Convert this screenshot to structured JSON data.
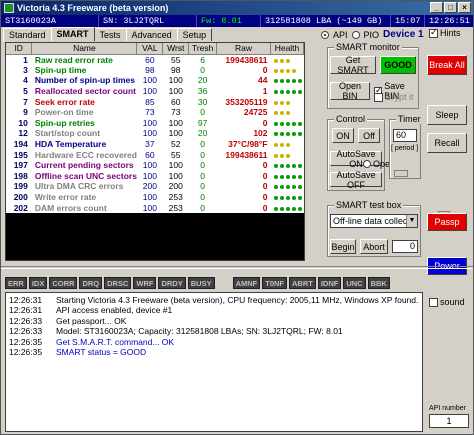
{
  "window": {
    "title": "Victoria 4.3 Freeware (beta version)",
    "min": "_",
    "max": "□",
    "close": "×"
  },
  "infobar": {
    "model": "ST3160023A",
    "serial": "SN: 3LJ2TQRL",
    "firmware": "Fw: 8.01",
    "lba": "312581808 LBA (~149 GB)",
    "time1": "15:07",
    "time2": "12:26:51"
  },
  "tabs": [
    {
      "label": "Standard"
    },
    {
      "label": "SMART",
      "active": true
    },
    {
      "label": "Tests"
    },
    {
      "label": "Advanced"
    },
    {
      "label": "Setup"
    }
  ],
  "mode": {
    "api": "API",
    "pio": "PIO",
    "device": "Device 1",
    "hints": "Hints"
  },
  "table": {
    "headers": [
      "ID",
      "Name",
      "VAL",
      "Wrst",
      "Tresh",
      "Raw",
      "Health"
    ],
    "rows": [
      {
        "id": "1",
        "name": "Raw read error rate",
        "val": "60",
        "wrst": "55",
        "tresh": "6",
        "raw": "199438611",
        "health": 3,
        "color": "green"
      },
      {
        "id": "3",
        "name": "Spin-up time",
        "val": "98",
        "wrst": "98",
        "tresh": "0",
        "raw": "0",
        "health": 4,
        "color": "green"
      },
      {
        "id": "4",
        "name": "Number of spin-up times",
        "val": "100",
        "wrst": "100",
        "tresh": "20",
        "raw": "44",
        "health": 5,
        "color": "blue"
      },
      {
        "id": "5",
        "name": "Reallocated sector count",
        "val": "100",
        "wrst": "100",
        "tresh": "36",
        "raw": "1",
        "health": 5,
        "color": "purple"
      },
      {
        "id": "7",
        "name": "Seek error rate",
        "val": "85",
        "wrst": "60",
        "tresh": "30",
        "raw": "353205119",
        "health": 3,
        "color": "red"
      },
      {
        "id": "9",
        "name": "Power-on time",
        "val": "73",
        "wrst": "73",
        "tresh": "0",
        "raw": "24725",
        "health": 3,
        "color": "gray"
      },
      {
        "id": "10",
        "name": "Spin-up retries",
        "val": "100",
        "wrst": "100",
        "tresh": "97",
        "raw": "0",
        "health": 5,
        "color": "green"
      },
      {
        "id": "12",
        "name": "Start/stop count",
        "val": "100",
        "wrst": "100",
        "tresh": "20",
        "raw": "102",
        "health": 5,
        "color": "gray"
      },
      {
        "id": "194",
        "name": "HDA Temperature",
        "val": "37",
        "wrst": "52",
        "tresh": "0",
        "raw": "37°C/98°F",
        "health": 3,
        "color": "blue"
      },
      {
        "id": "195",
        "name": "Hardware ECC recovered",
        "val": "60",
        "wrst": "55",
        "tresh": "0",
        "raw": "199438611",
        "health": 3,
        "color": "gray"
      },
      {
        "id": "197",
        "name": "Current pending sectors",
        "val": "100",
        "wrst": "100",
        "tresh": "0",
        "raw": "0",
        "health": 5,
        "color": "purple"
      },
      {
        "id": "198",
        "name": "Offline scan UNC sectors",
        "val": "100",
        "wrst": "100",
        "tresh": "0",
        "raw": "0",
        "health": 5,
        "color": "purple"
      },
      {
        "id": "199",
        "name": "Ultra DMA CRC errors",
        "val": "200",
        "wrst": "200",
        "tresh": "0",
        "raw": "0",
        "health": 5,
        "color": "gray"
      },
      {
        "id": "200",
        "name": "Write error rate",
        "val": "100",
        "wrst": "253",
        "tresh": "0",
        "raw": "0",
        "health": 5,
        "color": "gray"
      },
      {
        "id": "202",
        "name": "DAM errors count",
        "val": "100",
        "wrst": "253",
        "tresh": "0",
        "raw": "0",
        "health": 5,
        "color": "gray"
      }
    ]
  },
  "smart_monitor": {
    "title": "SMART monitor",
    "get_smart": "Get SMART",
    "status": "GOOD",
    "open_bin": "Open BIN",
    "save_bin": "Save BIN",
    "crypt_it": "Crypt it"
  },
  "control": {
    "title": "Control",
    "on": "ON",
    "off": "Off",
    "open_file": "Open file",
    "autosave_on": "AutoSave ON",
    "autosave_off": "AutoSave OFF"
  },
  "timer": {
    "title": "Timer",
    "value": "60",
    "period": "[ period ]"
  },
  "test_box": {
    "title": "SMART test box",
    "selected": "Off-line data collect",
    "begin": "Begin",
    "abort": "Abort",
    "counter": "0"
  },
  "right_buttons": {
    "break_all": "Break All",
    "sleep": "Sleep",
    "recall": "Recall",
    "passp": "Passp",
    "power": "Power"
  },
  "leds": [
    "ERR",
    "IDX",
    "CORR",
    "DRQ",
    "DRSC",
    "WRF",
    "DRDY",
    "BUSY",
    "AMNF",
    "T0NF",
    "ABRT",
    "IDNF",
    "UNC",
    "BBK"
  ],
  "log": [
    {
      "time": "12:26:31",
      "msg": "Starting Victoria 4.3 Freeware (beta version), CPU frequency: 2005,11 MHz, Windows XP found.",
      "color": "#000000"
    },
    {
      "time": "12:26:31",
      "msg": "API access enabled, device #1",
      "color": "#000000"
    },
    {
      "time": "12:26:33",
      "msg": "Get passport... OK",
      "color": "#000000"
    },
    {
      "time": "12:26:33",
      "msg": "Model: ST3160023A; Capacity: 312581808 LBAs; SN: 3LJ2TQRL; FW: 8.01",
      "color": "#000000"
    },
    {
      "time": "12:26:35",
      "msg": "Get S.M.A.R.T. command... OK",
      "color": "#0000c0"
    },
    {
      "time": "12:26:35",
      "msg": "SMART status = GOOD",
      "color": "#0000c0"
    }
  ],
  "sound": "sound",
  "api_number": {
    "label": "API number",
    "value": "1"
  }
}
